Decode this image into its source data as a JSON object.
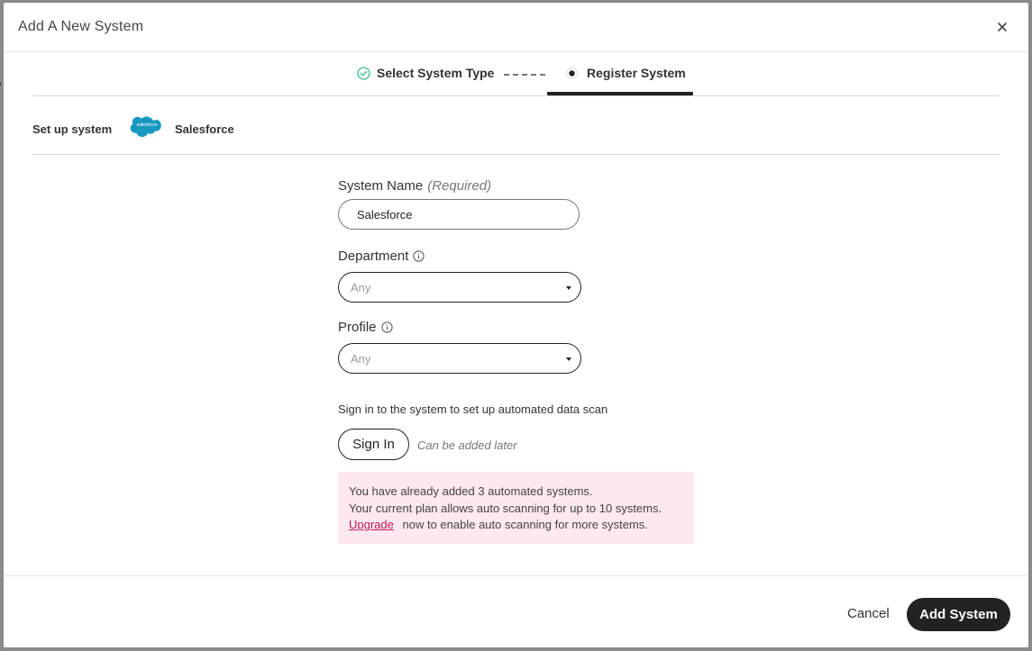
{
  "modal": {
    "title": "Add A New System"
  },
  "steps": [
    {
      "label": "Select System Type",
      "state": "completed"
    },
    {
      "label": "Register System",
      "state": "active"
    }
  ],
  "setup": {
    "label": "Set up system",
    "logo_text": "salesforce",
    "system_name": "Salesforce"
  },
  "form": {
    "system_name": {
      "label": "System Name",
      "required_note": "(Required)",
      "value": "Salesforce"
    },
    "department": {
      "label": "Department",
      "selected": "Any"
    },
    "profile": {
      "label": "Profile",
      "selected": "Any"
    },
    "signin_hint": "Sign in to the system to set up automated data scan",
    "signin_button": "Sign In",
    "later_note": "Can be added later"
  },
  "notice": {
    "line1": "You have already added 3 automated systems.",
    "line2": "Your current plan allows auto scanning for up to 10 systems.",
    "upgrade_link": "Upgrade",
    "line3_rest": "now to enable auto scanning for more systems."
  },
  "footer": {
    "cancel_label": "Cancel",
    "add_label": "Add System"
  },
  "colors": {
    "accent_dark": "#222222",
    "check_green": "#3dbf8a",
    "salesforce_blue": "#1798c1",
    "notice_bg": "#fde8f0",
    "link_pink": "#c2185b"
  }
}
